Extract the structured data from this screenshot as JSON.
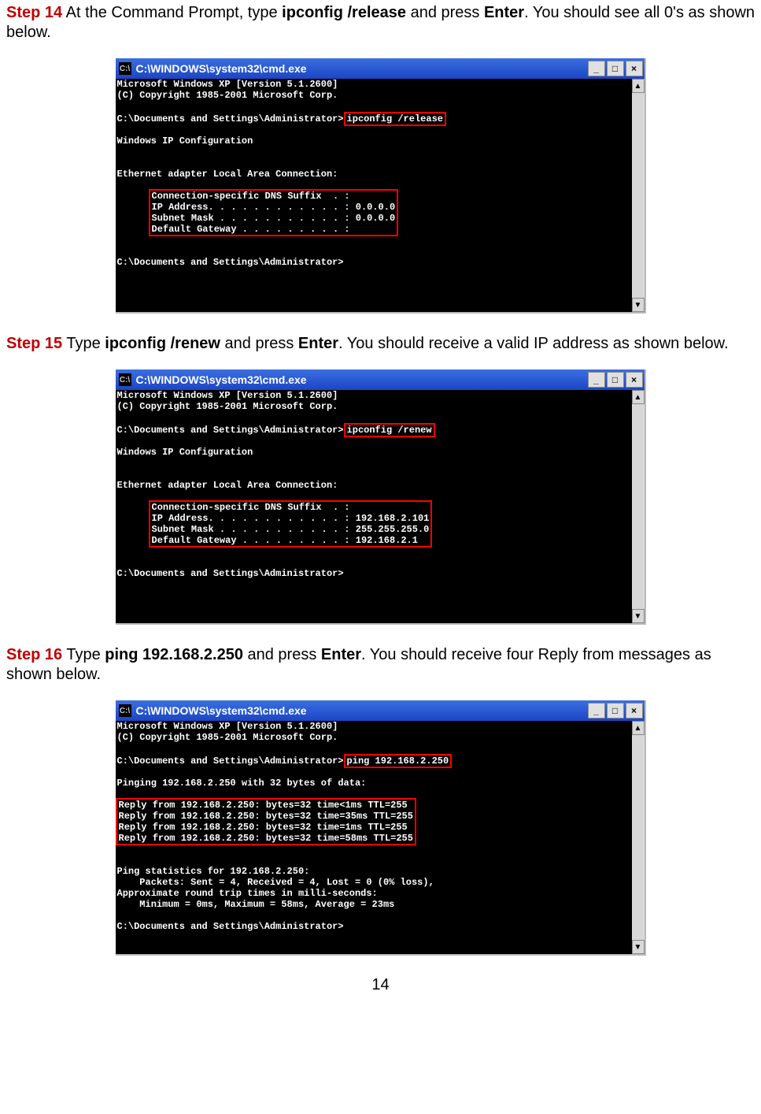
{
  "page_number": "14",
  "steps": {
    "s14": {
      "label": "Step 14",
      "pre_text": " At the Command Prompt, type ",
      "cmd_bold": "ipconfig /release",
      "mid_text": " and press ",
      "enter_bold": "Enter",
      "post_text": ". You should see all 0's as shown below."
    },
    "s15": {
      "label": "Step 15",
      "pre_text": " Type ",
      "cmd_bold": "ipconfig /renew",
      "mid_text": " and press ",
      "enter_bold": "Enter",
      "post_text": ". You should receive a valid IP address as shown below."
    },
    "s16": {
      "label": "Step 16",
      "pre_text": " Type ",
      "cmd_bold": "ping 192.168.2.250",
      "mid_text": " and press ",
      "enter_bold": "Enter",
      "post_text": ". You should receive four Reply from messages as shown below."
    }
  },
  "cmd_title": "C:\\WINDOWS\\system32\\cmd.exe",
  "win_icon_label": "C:\\",
  "win_buttons": {
    "min": "_",
    "max": "□",
    "close": "×"
  },
  "term1": {
    "header1": "Microsoft Windows XP [Version 5.1.2600]",
    "header2": "(C) Copyright 1985-2001 Microsoft Corp.",
    "prompt_path": "C:\\Documents and Settings\\Administrator>",
    "cmd": "ipconfig /release",
    "cfg_title": "Windows IP Configuration",
    "adapter": "Ethernet adapter Local Area Connection:",
    "dns": "Connection-specific DNS Suffix  . :",
    "ip": "IP Address. . . . . . . . . . . . : 0.0.0.0",
    "mask": "Subnet Mask . . . . . . . . . . . : 0.0.0.0",
    "gw": "Default Gateway . . . . . . . . . :",
    "prompt2": "C:\\Documents and Settings\\Administrator>"
  },
  "term2": {
    "header1": "Microsoft Windows XP [Version 5.1.2600]",
    "header2": "(C) Copyright 1985-2001 Microsoft Corp.",
    "prompt_path": "C:\\Documents and Settings\\Administrator>",
    "cmd": "ipconfig /renew",
    "cfg_title": "Windows IP Configuration",
    "adapter": "Ethernet adapter Local Area Connection:",
    "dns": "Connection-specific DNS Suffix  . :",
    "ip": "IP Address. . . . . . . . . . . . : 192.168.2.101",
    "mask": "Subnet Mask . . . . . . . . . . . : 255.255.255.0",
    "gw": "Default Gateway . . . . . . . . . : 192.168.2.1",
    "prompt2": "C:\\Documents and Settings\\Administrator>"
  },
  "term3": {
    "header1": "Microsoft Windows XP [Version 5.1.2600]",
    "header2": "(C) Copyright 1985-2001 Microsoft Corp.",
    "prompt_path": "C:\\Documents and Settings\\Administrator>",
    "cmd": "ping 192.168.2.250",
    "pinging": "Pinging 192.168.2.250 with 32 bytes of data:",
    "r1": "Reply from 192.168.2.250: bytes=32 time<1ms TTL=255",
    "r2": "Reply from 192.168.2.250: bytes=32 time=35ms TTL=255",
    "r3": "Reply from 192.168.2.250: bytes=32 time=1ms TTL=255",
    "r4": "Reply from 192.168.2.250: bytes=32 time=58ms TTL=255",
    "stats1": "Ping statistics for 192.168.2.250:",
    "stats2": "    Packets: Sent = 4, Received = 4, Lost = 0 (0% loss),",
    "stats3": "Approximate round trip times in milli-seconds:",
    "stats4": "    Minimum = 0ms, Maximum = 58ms, Average = 23ms",
    "prompt2": "C:\\Documents and Settings\\Administrator>"
  }
}
